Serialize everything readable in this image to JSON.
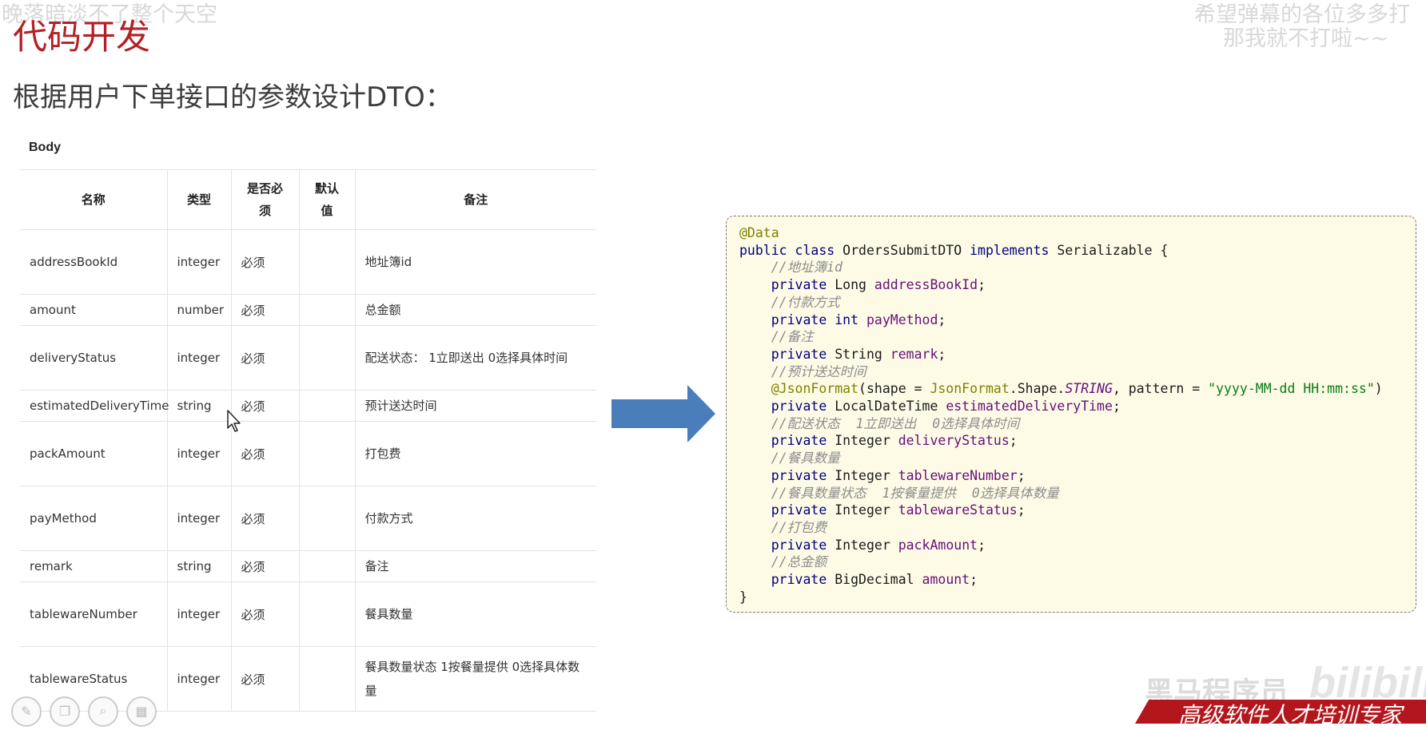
{
  "slide": {
    "title": "代码开发",
    "subtitle": "根据用户下单接口的参数设计DTO："
  },
  "danmaku": {
    "left": "晚落暗淡不了整个天空",
    "right_line1": "希望弹幕的各位多多打",
    "right_line2": "那我就不打啦~~"
  },
  "table": {
    "section_label": "Body",
    "headers": {
      "name": "名称",
      "type": "类型",
      "required": "是否必须",
      "default": "默认值",
      "remark": "备注"
    },
    "rows": [
      {
        "name": "addressBookId",
        "type": "integer",
        "required": "必须",
        "default": "",
        "remark": "地址簿id"
      },
      {
        "name": "amount",
        "type": "number",
        "required": "必须",
        "default": "",
        "remark": "总金额"
      },
      {
        "name": "deliveryStatus",
        "type": "integer",
        "required": "必须",
        "default": "",
        "remark": "配送状态： 1立即送出 0选择具体时间"
      },
      {
        "name": "estimatedDeliveryTime",
        "type": "string",
        "required": "必须",
        "default": "",
        "remark": "预计送达时间"
      },
      {
        "name": "packAmount",
        "type": "integer",
        "required": "必须",
        "default": "",
        "remark": "打包费"
      },
      {
        "name": "payMethod",
        "type": "integer",
        "required": "必须",
        "default": "",
        "remark": "付款方式"
      },
      {
        "name": "remark",
        "type": "string",
        "required": "必须",
        "default": "",
        "remark": "备注"
      },
      {
        "name": "tablewareNumber",
        "type": "integer",
        "required": "必须",
        "default": "",
        "remark": "餐具数量"
      },
      {
        "name": "tablewareStatus",
        "type": "integer",
        "required": "必须",
        "default": "",
        "remark": "餐具数量状态 1按餐量提供 0选择具体数量"
      }
    ]
  },
  "code": {
    "l1": "@Data",
    "l2_kw1": "public class",
    "l2_name": " OrdersSubmitDTO ",
    "l2_kw2": "implements",
    "l2_rest": " Serializable {",
    "c1": "//地址簿id",
    "f1_type": "Long",
    "f1_name": "addressBookId",
    "c2": "//付款方式",
    "f2_type": "int",
    "f2_name": "payMethod",
    "c3": "//备注",
    "f3_type": "String",
    "f3_name": "remark",
    "c4": "//预计送达时间",
    "ann_json": "@JsonFormat",
    "ann_shape": "(shape = ",
    "ann_json2": "JsonFormat",
    "ann_shape2": ".Shape.",
    "ann_const": "STRING",
    "ann_pattern": ", pattern = ",
    "ann_str": "\"yyyy-MM-dd HH:mm:ss\"",
    "ann_close": ")",
    "f4_type": "LocalDateTime",
    "f4_name": "estimatedDeliveryTime",
    "c5": "//配送状态  1立即送出  0选择具体时间",
    "f5_type": "Integer",
    "f5_name": "deliveryStatus",
    "c6": "//餐具数量",
    "f6_type": "Integer",
    "f6_name": "tablewareNumber",
    "c7": "//餐具数量状态  1按餐量提供  0选择具体数量",
    "f7_type": "Integer",
    "f7_name": "tablewareStatus",
    "c8": "//打包费",
    "f8_type": "Integer",
    "f8_name": "packAmount",
    "c9": "//总金额",
    "f9_type": "BigDecimal",
    "f9_name": "amount",
    "private_kw": "private",
    "close": "}"
  },
  "footer": {
    "watermark": "黑马程序员",
    "bili": "bilibili",
    "banner": "高级软件人才培训专家"
  },
  "colors": {
    "title_red": "#b32025",
    "arrow_blue": "#4a7ebb",
    "code_bg": "#fdfbe6",
    "banner_red": "#b3161c"
  },
  "icons": [
    "pen-icon",
    "copy-icon",
    "search-icon",
    "grid-icon",
    "mouse-cursor-icon"
  ]
}
